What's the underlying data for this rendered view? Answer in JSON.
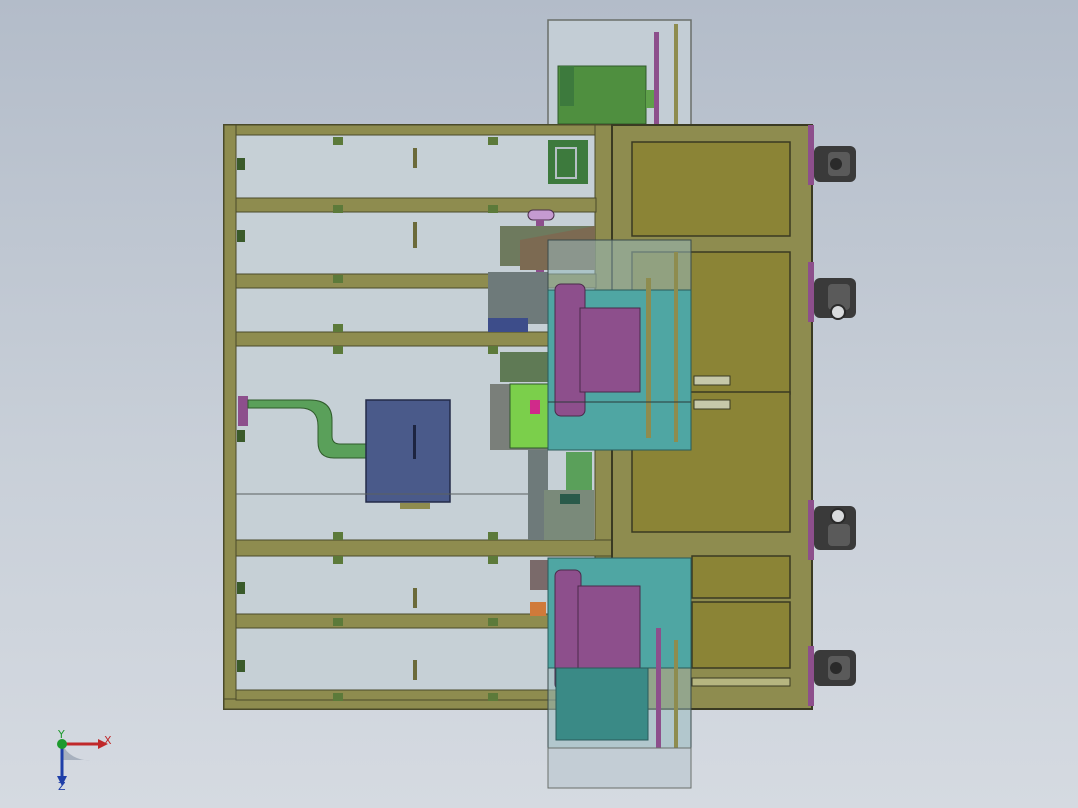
{
  "viewport": {
    "background_top": "#b3bcc9",
    "background_bottom": "#d5dae1"
  },
  "colors": {
    "frame": "#8e8c4f",
    "frame_dark": "#5b5a2e",
    "glass": "#c9d3da",
    "cabinet_panel": "#8b8436",
    "teal_guard": "#4fa6a3",
    "roller_purple": "#8d4f8c",
    "motor_blue": "#4a5a8a",
    "pipe_green": "#5aa05a",
    "dark_green_block": "#3d7a3d",
    "caster_dark": "#3a3a3a"
  },
  "model": {
    "name": "machine-assembly-top-view",
    "icons": [
      "caster-wheel-icon",
      "roller-drum-icon",
      "motor-box-icon",
      "duct-pipe-icon"
    ]
  },
  "triad": {
    "x_label": "X",
    "y_label": "Y",
    "z_label": "Z",
    "x_color": "#c0282a",
    "y_color": "#1d9a2d",
    "z_color": "#1f3fa8"
  }
}
